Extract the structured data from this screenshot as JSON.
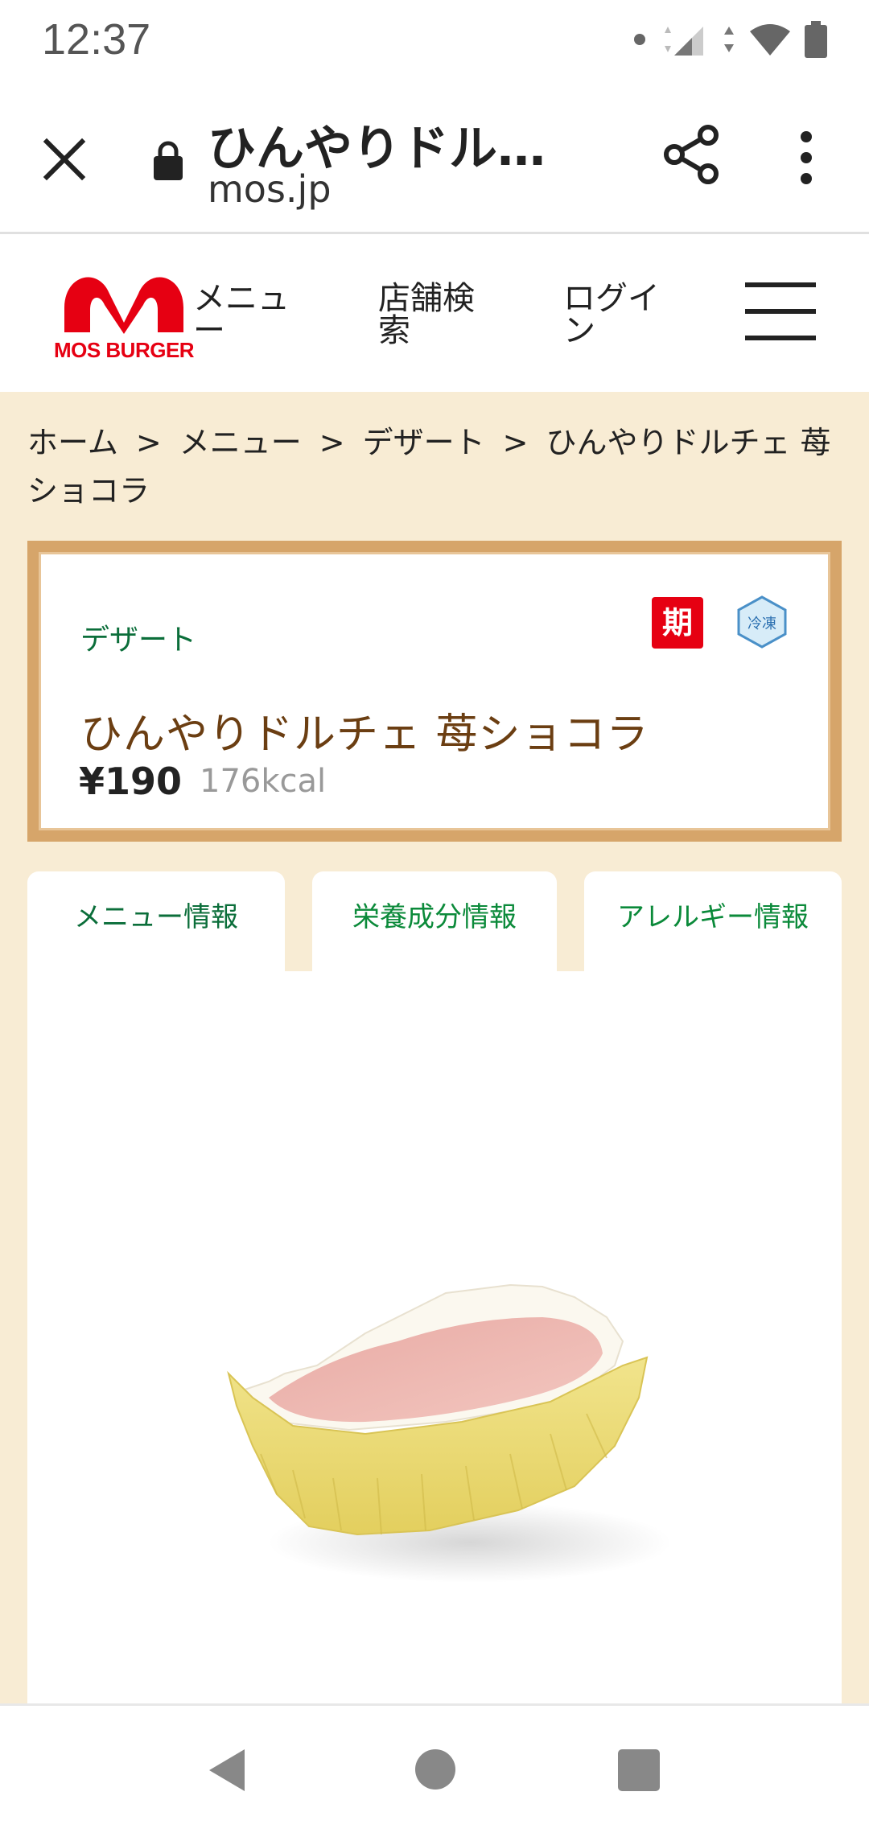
{
  "status": {
    "time": "12:37"
  },
  "browser": {
    "title": "ひんやりドル…",
    "domain": "mos.jp"
  },
  "header": {
    "logo_text": "MOS BURGER",
    "nav": {
      "menu": "メニュー",
      "store": "店舗検索",
      "login": "ログイン"
    }
  },
  "breadcrumb": {
    "items": [
      "ホーム",
      "メニュー",
      "デザート",
      "ひんやりドルチェ 苺ショコラ"
    ],
    "separator": ">"
  },
  "product": {
    "category": "デザート",
    "badge_limited": "期",
    "badge_frozen": "冷凍",
    "name": "ひんやりドルチェ 苺ショコラ",
    "price": "¥190",
    "kcal": "176kcal"
  },
  "tabs": [
    {
      "label": "メニュー情報",
      "active": true
    },
    {
      "label": "栄養成分情報",
      "active": false
    },
    {
      "label": "アレルギー情報",
      "active": false
    }
  ],
  "colors": {
    "brand_red": "#e60012",
    "accent_green": "#0b6e3a",
    "card_border": "#d6a56a",
    "page_bg": "#f8ecd4"
  }
}
